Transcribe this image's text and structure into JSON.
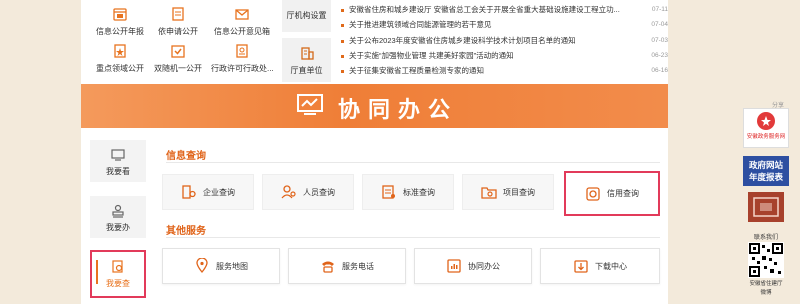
{
  "top": {
    "services": [
      {
        "label": "信息公开年报",
        "icon": "calendar-icon"
      },
      {
        "label": "依申请公开",
        "icon": "document-edit-icon"
      },
      {
        "label": "信息公开意见箱",
        "icon": "mail-icon"
      },
      {
        "label": "重点领域公开",
        "icon": "badge-icon"
      },
      {
        "label": "双随机一公开",
        "icon": "shield-check-icon"
      },
      {
        "label": "行政许可行政处...",
        "icon": "license-icon"
      }
    ],
    "side_buttons": [
      {
        "label": "厅机构设置",
        "icon": "org-icon"
      },
      {
        "label": "厅直单位",
        "icon": "building-icon"
      }
    ],
    "news": [
      {
        "title": "安徽省住房和城乡建设厅 安徽省总工会关于开展全省重大基础设施建设工程立功...",
        "date": "07-11"
      },
      {
        "title": "关于推进建筑领域合同能源管理的若干意见",
        "date": "07-04"
      },
      {
        "title": "关于公布2023年度安徽省住房城乡建设科学技术计划项目名单的通知",
        "date": "07-03"
      },
      {
        "title": "关于实施“加强物业管理 共建美好家园”活动的通知",
        "date": "06-23"
      },
      {
        "title": "关于征集安徽省工程质量检测专家的通知",
        "date": "06-16"
      }
    ]
  },
  "banner": {
    "title": "协同办公",
    "icon": "monitor-chart-icon"
  },
  "tabs": [
    {
      "label": "我要看",
      "icon": "monitor-icon",
      "active": false
    },
    {
      "label": "我要办",
      "icon": "stamp-icon",
      "active": false
    },
    {
      "label": "我要查",
      "icon": "search-doc-icon",
      "active": true
    }
  ],
  "info_query": {
    "title": "信息查询",
    "items": [
      {
        "label": "企业查询",
        "icon": "enterprise-icon"
      },
      {
        "label": "人员查询",
        "icon": "person-search-icon"
      },
      {
        "label": "标准查询",
        "icon": "standard-icon"
      },
      {
        "label": "项目查询",
        "icon": "folder-search-icon"
      },
      {
        "label": "信用查询",
        "icon": "credit-search-icon"
      }
    ]
  },
  "other_services": {
    "title": "其他服务",
    "items": [
      {
        "label": "服务地图",
        "icon": "map-pin-icon"
      },
      {
        "label": "服务电话",
        "icon": "phone-icon"
      },
      {
        "label": "协同办公",
        "icon": "collab-icon"
      },
      {
        "label": "下载中心",
        "icon": "download-icon"
      }
    ]
  },
  "right": {
    "share": "分享",
    "gov_service_logo": "安徽政务服务网",
    "report_line1": "政府网站",
    "report_line2": "年度报表",
    "contact": "联系我们",
    "qr_caption_1": "安徽省住建厅",
    "qr_caption_2": "微博"
  },
  "colors": {
    "accent": "#e8731f",
    "banner": "#ef7e37",
    "highlight": "#e23a5a",
    "report_blue": "#2d4fa1"
  }
}
